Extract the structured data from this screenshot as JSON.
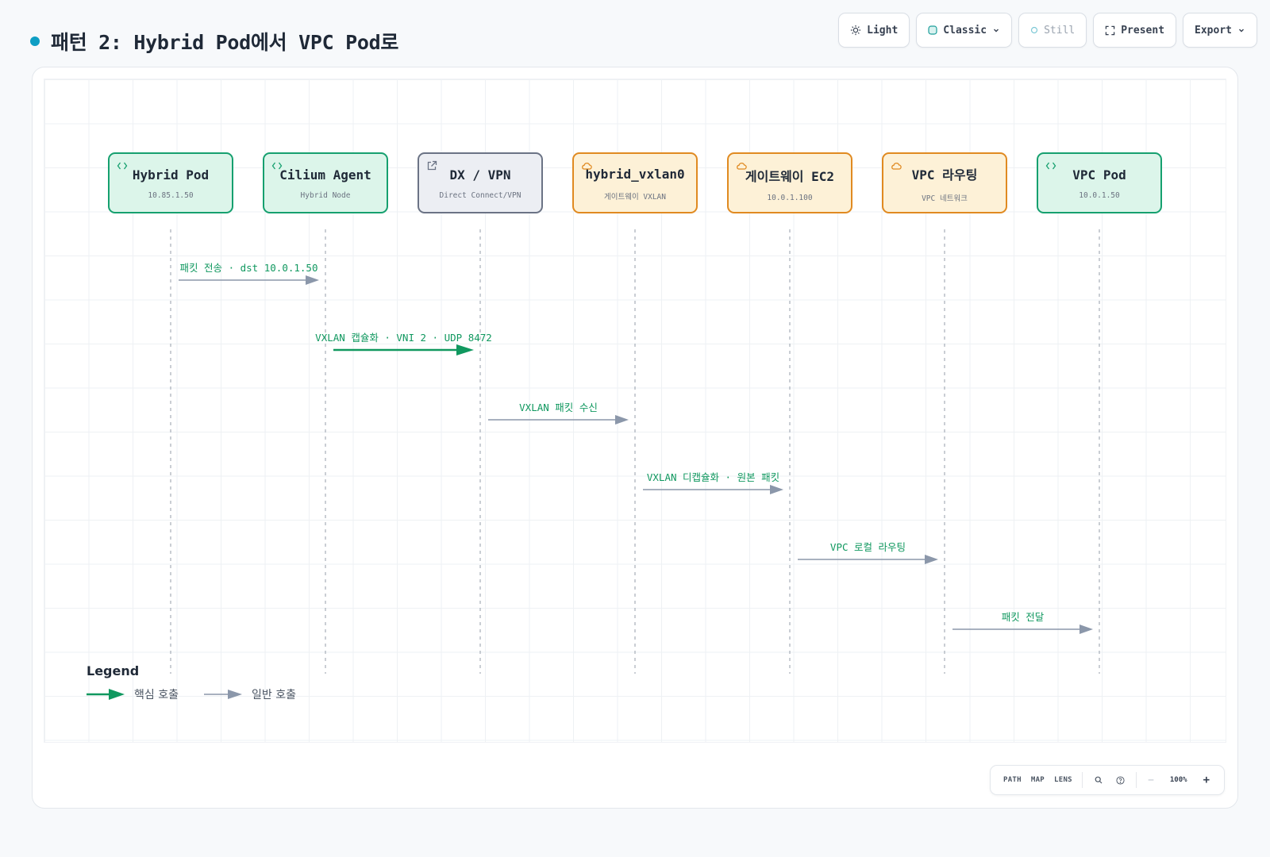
{
  "page": {
    "title": "패턴 2: Hybrid Pod에서 VPC Pod로",
    "accent": "#0e9ec4"
  },
  "toolbar": {
    "theme_label": "Light",
    "style_label": "Classic",
    "motion_label": "Still",
    "present_label": "Present",
    "export_label": "Export"
  },
  "diagram": {
    "actors": [
      {
        "title": "Hybrid Pod",
        "subtitle": "10.85.1.50",
        "kind": "green",
        "icon": "code-icon"
      },
      {
        "title": "Cilium Agent",
        "subtitle": "Hybrid Node",
        "kind": "green",
        "icon": "code-icon"
      },
      {
        "title": "DX / VPN",
        "subtitle": "Direct Connect/VPN",
        "kind": "gray",
        "icon": "external-link-icon"
      },
      {
        "title": "hybrid_vxlan0",
        "subtitle": "게이트웨이 VXLAN",
        "kind": "orange",
        "icon": "cloud-icon"
      },
      {
        "title": "게이트웨이 EC2",
        "subtitle": "10.0.1.100",
        "kind": "orange",
        "icon": "cloud-icon"
      },
      {
        "title": "VPC 라우팅",
        "subtitle": "VPC 네트워크",
        "kind": "orange",
        "icon": "cloud-icon"
      },
      {
        "title": "VPC Pod",
        "subtitle": "10.0.1.50",
        "kind": "green",
        "icon": "code-icon"
      }
    ],
    "messages": [
      {
        "from": 0,
        "to": 1,
        "label": "패킷 전송 · dst 10.0.1.50",
        "primary": false
      },
      {
        "from": 1,
        "to": 2,
        "label": "VXLAN 캡슐화 · VNI 2 · UDP 8472",
        "primary": true
      },
      {
        "from": 2,
        "to": 3,
        "label": "VXLAN 패킷 수신",
        "primary": false
      },
      {
        "from": 3,
        "to": 4,
        "label": "VXLAN 디캡슐화 · 원본 패킷",
        "primary": false
      },
      {
        "from": 4,
        "to": 5,
        "label": "VPC 로컬 라우팅",
        "primary": false
      },
      {
        "from": 5,
        "to": 6,
        "label": "패킷 전달",
        "primary": false
      }
    ],
    "colors": {
      "primary_arrow": "#10985f",
      "normal_arrow": "#8b97aa",
      "green_border": "#16a06f",
      "gray_border": "#6b7385",
      "orange_border": "#e08a21"
    }
  },
  "legend": {
    "title": "Legend",
    "primary_label": "핵심 호출",
    "normal_label": "일반 호출"
  },
  "controls": {
    "path": "PATH",
    "map": "MAP",
    "lens": "LENS",
    "zoom": "100%",
    "minus": "−",
    "plus": "+"
  }
}
